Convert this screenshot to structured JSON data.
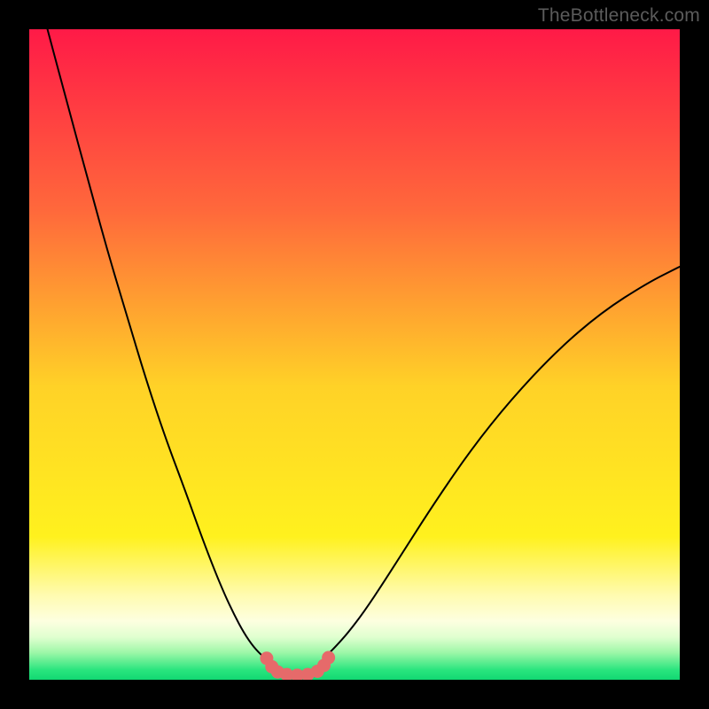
{
  "watermark": "TheBottleneck.com",
  "chart_data": {
    "type": "line",
    "title": "",
    "xlabel": "",
    "ylabel": "",
    "xlim": [
      0,
      1
    ],
    "ylim": [
      0,
      1
    ],
    "background_gradient": {
      "stops": [
        {
          "offset": 0.0,
          "color": "#ff1a47"
        },
        {
          "offset": 0.28,
          "color": "#ff693b"
        },
        {
          "offset": 0.55,
          "color": "#ffd227"
        },
        {
          "offset": 0.78,
          "color": "#fff11e"
        },
        {
          "offset": 0.87,
          "color": "#fffbb0"
        },
        {
          "offset": 0.91,
          "color": "#fdffe0"
        },
        {
          "offset": 0.935,
          "color": "#dfffcf"
        },
        {
          "offset": 0.958,
          "color": "#9ef7a8"
        },
        {
          "offset": 0.985,
          "color": "#29e57e"
        },
        {
          "offset": 1.0,
          "color": "#12d873"
        }
      ]
    },
    "series": [
      {
        "name": "curve-left",
        "stroke": "#000000",
        "stroke_width": 2,
        "x": [
          0.028,
          0.06,
          0.09,
          0.12,
          0.15,
          0.18,
          0.21,
          0.24,
          0.265,
          0.285,
          0.3,
          0.315,
          0.33,
          0.345,
          0.36
        ],
        "y": [
          1.0,
          0.88,
          0.77,
          0.66,
          0.56,
          0.46,
          0.37,
          0.29,
          0.22,
          0.168,
          0.132,
          0.1,
          0.072,
          0.05,
          0.035
        ]
      },
      {
        "name": "curve-right",
        "stroke": "#000000",
        "stroke_width": 2,
        "x": [
          0.455,
          0.47,
          0.49,
          0.515,
          0.545,
          0.58,
          0.625,
          0.68,
          0.74,
          0.81,
          0.88,
          0.95,
          1.0
        ],
        "y": [
          0.035,
          0.05,
          0.072,
          0.105,
          0.15,
          0.205,
          0.275,
          0.355,
          0.43,
          0.505,
          0.565,
          0.61,
          0.635
        ]
      },
      {
        "name": "bottom-dots",
        "type": "scatter",
        "fill": "#e66a6a",
        "r": 7.5,
        "x": [
          0.365,
          0.373,
          0.382,
          0.396,
          0.412,
          0.428,
          0.443,
          0.453,
          0.46
        ],
        "y": [
          0.033,
          0.02,
          0.012,
          0.008,
          0.007,
          0.008,
          0.013,
          0.022,
          0.034
        ]
      }
    ]
  }
}
